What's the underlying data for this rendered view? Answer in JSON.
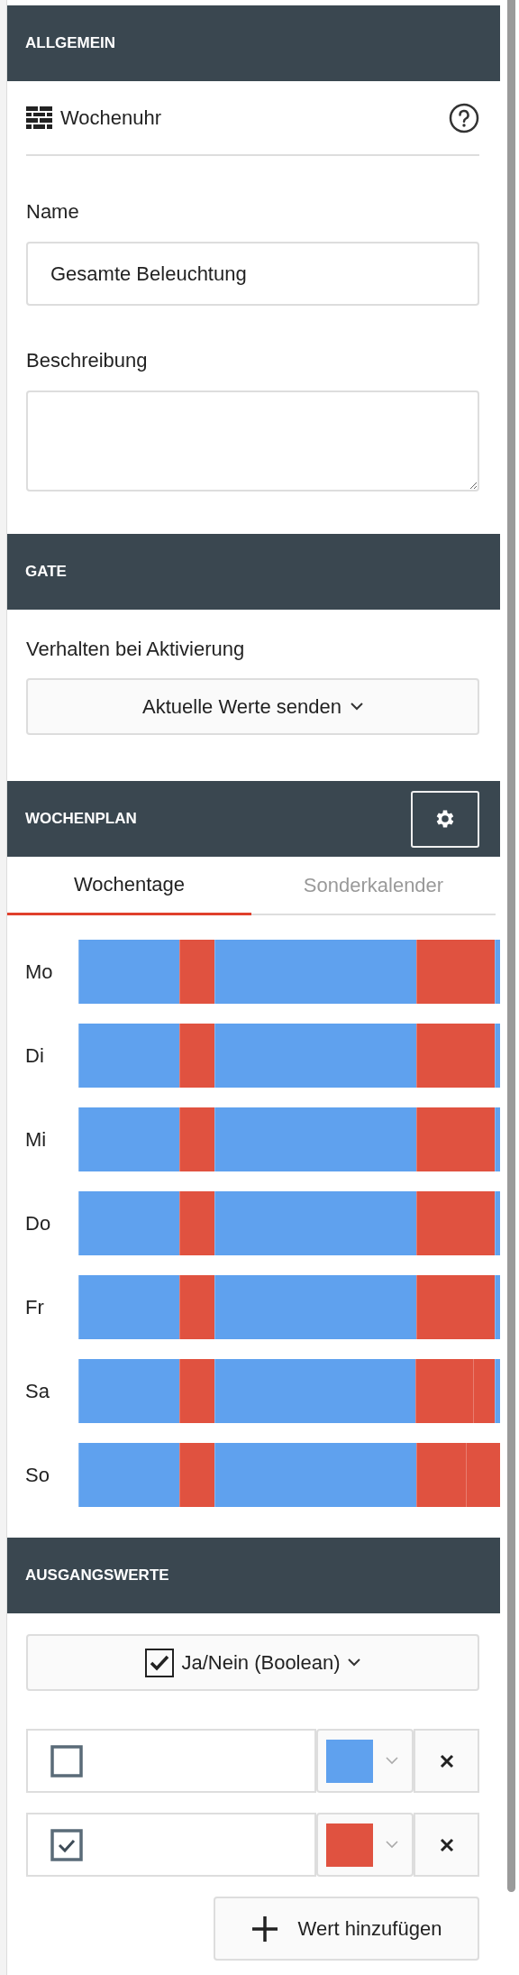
{
  "general": {
    "header": "ALLGEMEIN",
    "block_type": "Wochenuhr",
    "name_label": "Name",
    "name_value": "Gesamte Beleuchtung",
    "description_label": "Beschreibung"
  },
  "gate": {
    "header": "GATE",
    "behavior_label": "Verhalten bei Aktivierung",
    "behavior_value": "Aktuelle Werte senden"
  },
  "schedule": {
    "header": "WOCHENPLAN",
    "tabs": [
      {
        "label": "Wochentage",
        "selected": true
      },
      {
        "label": "Sonderkalender",
        "selected": false
      }
    ],
    "days": [
      {
        "label": "Mo",
        "segments": [
          {
            "color": "#5fa1ee"
          },
          {
            "color": "#e05240"
          },
          {
            "color": "#5fa1ee"
          },
          {
            "color": "#e05240"
          },
          {
            "color": "#5fa1ee"
          }
        ]
      },
      {
        "label": "Di",
        "segments": [
          {
            "color": "#5fa1ee"
          },
          {
            "color": "#e05240"
          },
          {
            "color": "#5fa1ee"
          },
          {
            "color": "#e05240"
          },
          {
            "color": "#5fa1ee"
          }
        ]
      },
      {
        "label": "Mi",
        "segments": [
          {
            "color": "#5fa1ee"
          },
          {
            "color": "#e05240"
          },
          {
            "color": "#5fa1ee"
          },
          {
            "color": "#e05240"
          },
          {
            "color": "#5fa1ee"
          }
        ]
      },
      {
        "label": "Do",
        "segments": [
          {
            "color": "#5fa1ee"
          },
          {
            "color": "#e05240"
          },
          {
            "color": "#5fa1ee"
          },
          {
            "color": "#e05240"
          },
          {
            "color": "#5fa1ee"
          }
        ]
      },
      {
        "label": "Fr",
        "segments": [
          {
            "color": "#5fa1ee"
          },
          {
            "color": "#e05240"
          },
          {
            "color": "#5fa1ee"
          },
          {
            "color": "#e05240"
          },
          {
            "color": "#5fa1ee"
          }
        ]
      },
      {
        "label": "Sa",
        "segments": [
          {
            "color": "#5fa1ee"
          },
          {
            "color": "#e05240"
          },
          {
            "color": "#5fa1ee"
          },
          {
            "color": "#e05240"
          },
          {
            "color": "#e05240"
          },
          {
            "color": "#5fa1ee"
          }
        ]
      },
      {
        "label": "So",
        "segments": [
          {
            "color": "#5fa1ee"
          },
          {
            "color": "#e05240"
          },
          {
            "color": "#5fa1ee"
          },
          {
            "color": "#e05240"
          },
          {
            "color": "#e05240"
          }
        ]
      }
    ]
  },
  "outputs": {
    "header": "AUSGANGSWERTE",
    "type": "Ja/Nein (Boolean)",
    "values": [
      {
        "checked": false,
        "color": "#5fa1ee"
      },
      {
        "checked": true,
        "color": "#e05240"
      }
    ],
    "add_button": "Wert hinzufügen"
  }
}
